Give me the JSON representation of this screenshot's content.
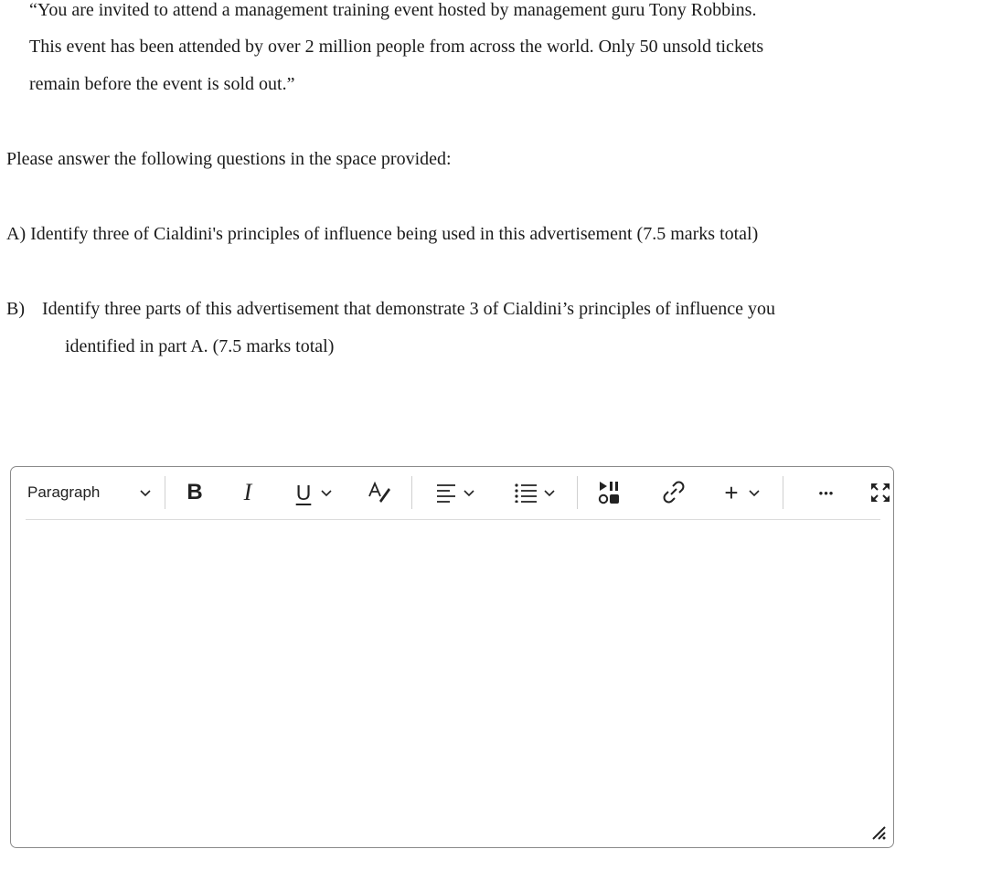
{
  "quote": {
    "lines": [
      "“You are invited to attend a management training event hosted by management guru Tony Robbins.",
      "This event has been attended by over 2 million people from across the world. Only 50 unsold tickets",
      "remain before the event is sold out.”"
    ]
  },
  "prompt": "Please answer the following questions in the space provided:",
  "question_a": "A) Identify three of Cialdini's principles of influence being used in this advertisement (7.5 marks total)",
  "question_b": {
    "letter": "B)",
    "line1": "Identify three parts of this advertisement that demonstrate 3 of Cialdini’s principles of influence you",
    "line2": "identified in part A. (7.5 marks total)"
  },
  "editor": {
    "block_format": "Paragraph",
    "bold_label": "B",
    "italic_label": "I",
    "underline_label": "U",
    "insert_label": "+",
    "more_label": "•••",
    "content": ""
  },
  "colors": {
    "text": "#1b1b1b",
    "border": "#8a8a8a",
    "toolbar_divider": "#dcdcdc"
  }
}
